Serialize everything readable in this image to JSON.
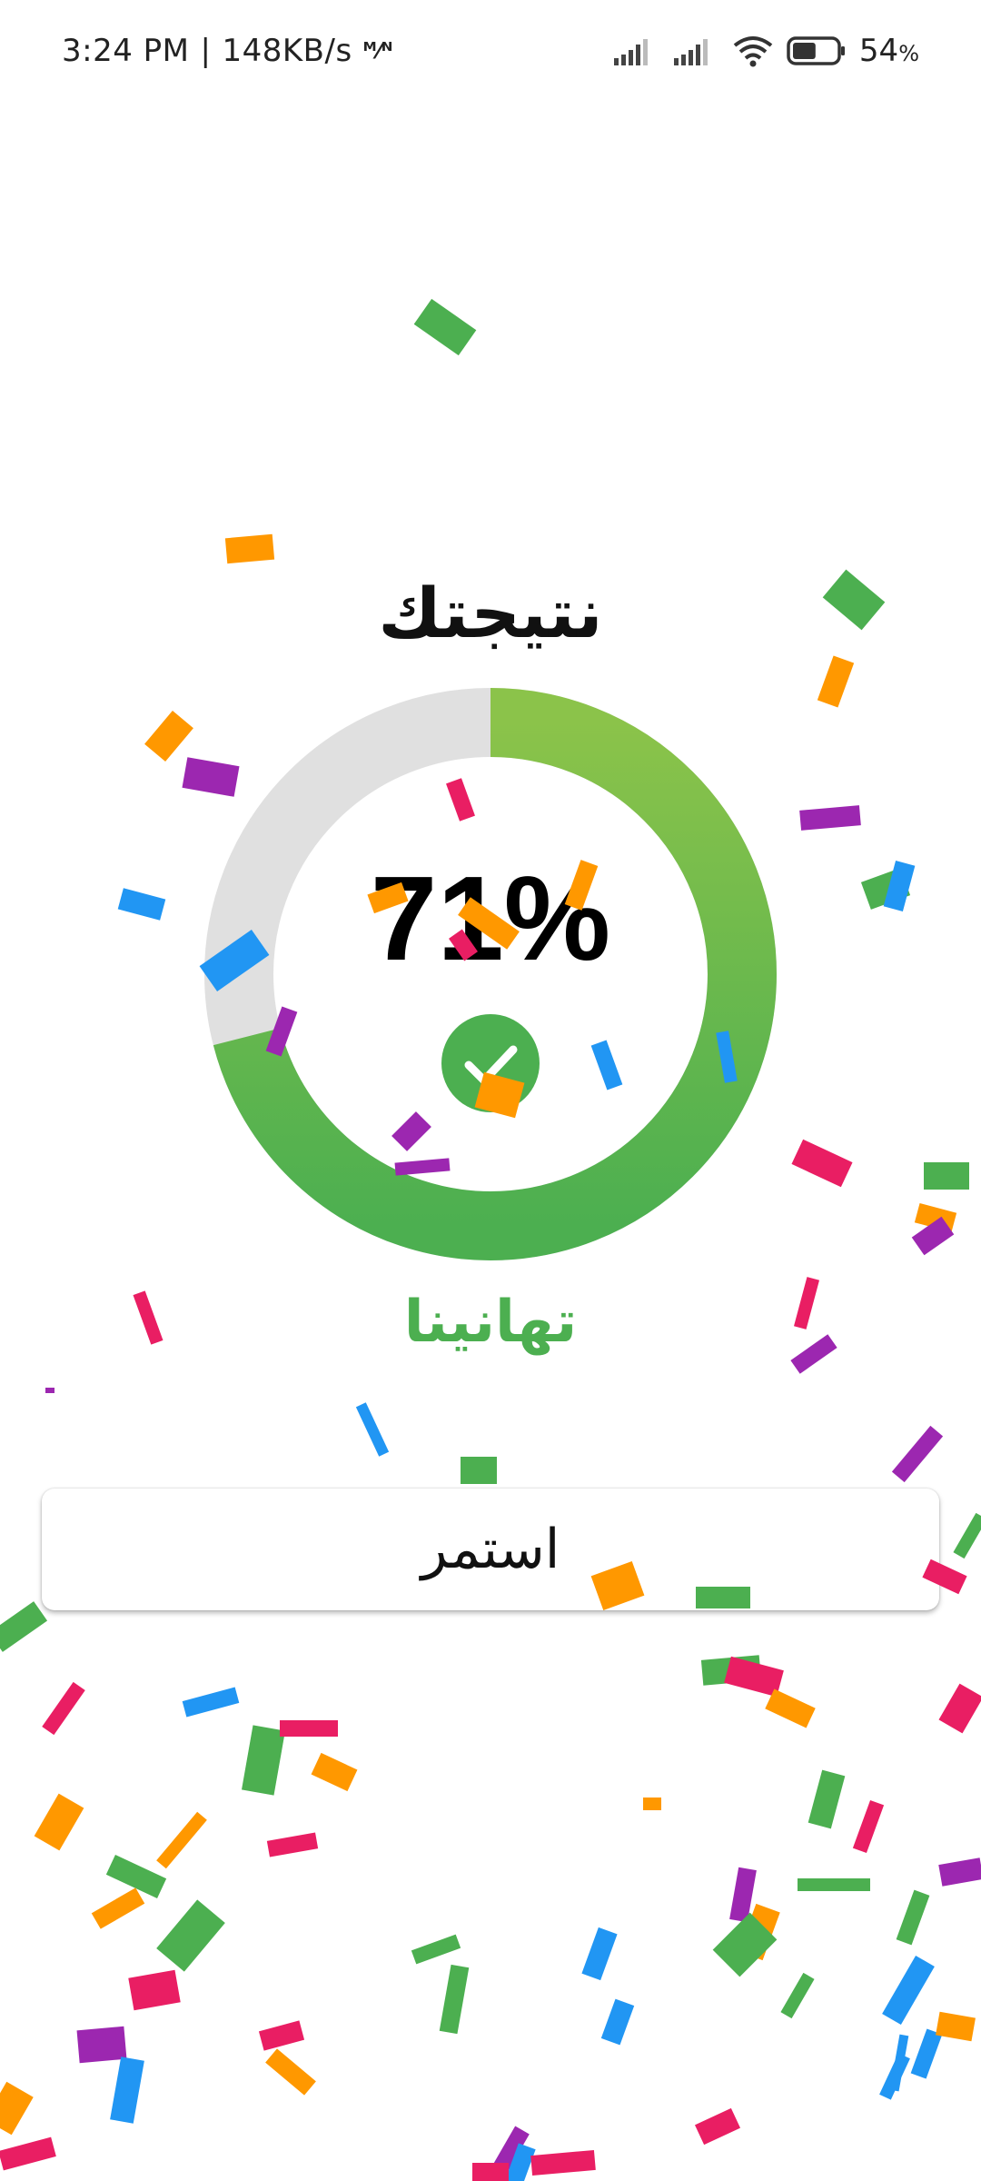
{
  "status_bar": {
    "time": "3:24 PM",
    "separator": "|",
    "network_speed": "148KB/s",
    "speed_icon": "network-speed-icon",
    "signal_icons": [
      "signal-sim1-icon",
      "signal-sim2-icon"
    ],
    "wifi_icon": "wifi-icon",
    "battery_icon": "battery-icon",
    "battery_level": 54,
    "battery_number": "54",
    "battery_unit": "%"
  },
  "result": {
    "title": "نتيجتك",
    "percent_label": "71%",
    "score": 71,
    "score_max": 100,
    "check_icon": "check-circle-icon",
    "congrats": "تهانينا"
  },
  "continue_button": {
    "label": "استمر"
  },
  "colors": {
    "ring_start": "#4caf50",
    "ring_end": "#8bc34a",
    "ring_track": "#e0e0e0",
    "congrats_green": "#4caf50",
    "confetti": [
      "#4caf50",
      "#ff9800",
      "#9c27b0",
      "#2196f3",
      "#e91e63"
    ]
  }
}
